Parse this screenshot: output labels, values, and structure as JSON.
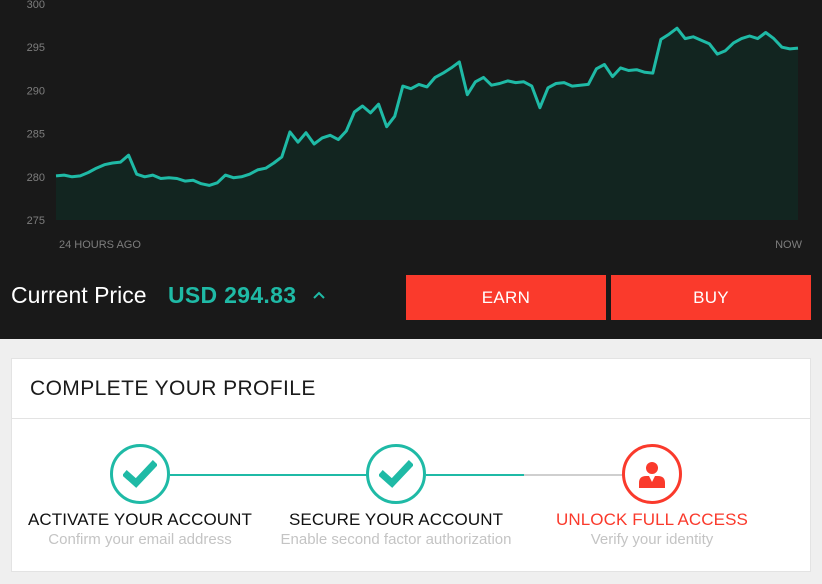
{
  "chart_data": {
    "type": "area",
    "x_start_label": "24 HOURS AGO",
    "x_end_label": "NOW",
    "ylim": [
      275,
      300
    ],
    "yticks": [
      275,
      280,
      285,
      290,
      295,
      300
    ],
    "line_color": "#1fbaa6",
    "fill_color": "#122520",
    "values": [
      280.1,
      280.2,
      280.0,
      280.1,
      280.5,
      281.0,
      281.4,
      281.6,
      281.7,
      282.5,
      280.3,
      280.0,
      280.2,
      279.8,
      279.9,
      279.8,
      279.5,
      279.6,
      279.2,
      279.0,
      279.3,
      280.2,
      279.9,
      280.0,
      280.3,
      280.8,
      281.0,
      281.6,
      282.3,
      285.2,
      284.0,
      285.1,
      283.8,
      284.5,
      284.8,
      284.3,
      285.3,
      287.5,
      288.2,
      287.4,
      288.4,
      285.8,
      287.0,
      290.5,
      290.2,
      290.7,
      290.4,
      291.5,
      292.0,
      292.6,
      293.3,
      289.5,
      291.0,
      291.5,
      290.6,
      290.8,
      291.1,
      290.9,
      291.0,
      290.5,
      288.0,
      290.3,
      290.8,
      290.9,
      290.5,
      290.6,
      290.7,
      292.5,
      293.0,
      291.6,
      292.6,
      292.3,
      292.4,
      292.1,
      292.0,
      295.9,
      296.5,
      297.2,
      296.0,
      296.2,
      295.8,
      295.4,
      294.2,
      294.6,
      295.5,
      296.0,
      296.3,
      296.0,
      296.7,
      296.0,
      295.0,
      294.8,
      294.9
    ]
  },
  "market": {
    "price_label": "Current Price",
    "price_value": "USD 294.83",
    "trend": "up",
    "earn_label": "EARN",
    "buy_label": "BUY"
  },
  "profile": {
    "title": "COMPLETE YOUR PROFILE",
    "steps": [
      {
        "title": "ACTIVATE YOUR ACCOUNT",
        "subtitle": "Confirm your email address",
        "status": "complete",
        "icon": "checkmark-icon"
      },
      {
        "title": "SECURE YOUR ACCOUNT",
        "subtitle": "Enable second factor authorization",
        "status": "complete",
        "icon": "checkmark-icon"
      },
      {
        "title": "UNLOCK FULL ACCESS",
        "subtitle": "Verify your identity",
        "status": "current",
        "icon": "user-icon"
      }
    ],
    "colors": {
      "complete": "#1fbaa6",
      "current": "#fa3a2c",
      "pending_line": "#cfcfcf"
    }
  }
}
